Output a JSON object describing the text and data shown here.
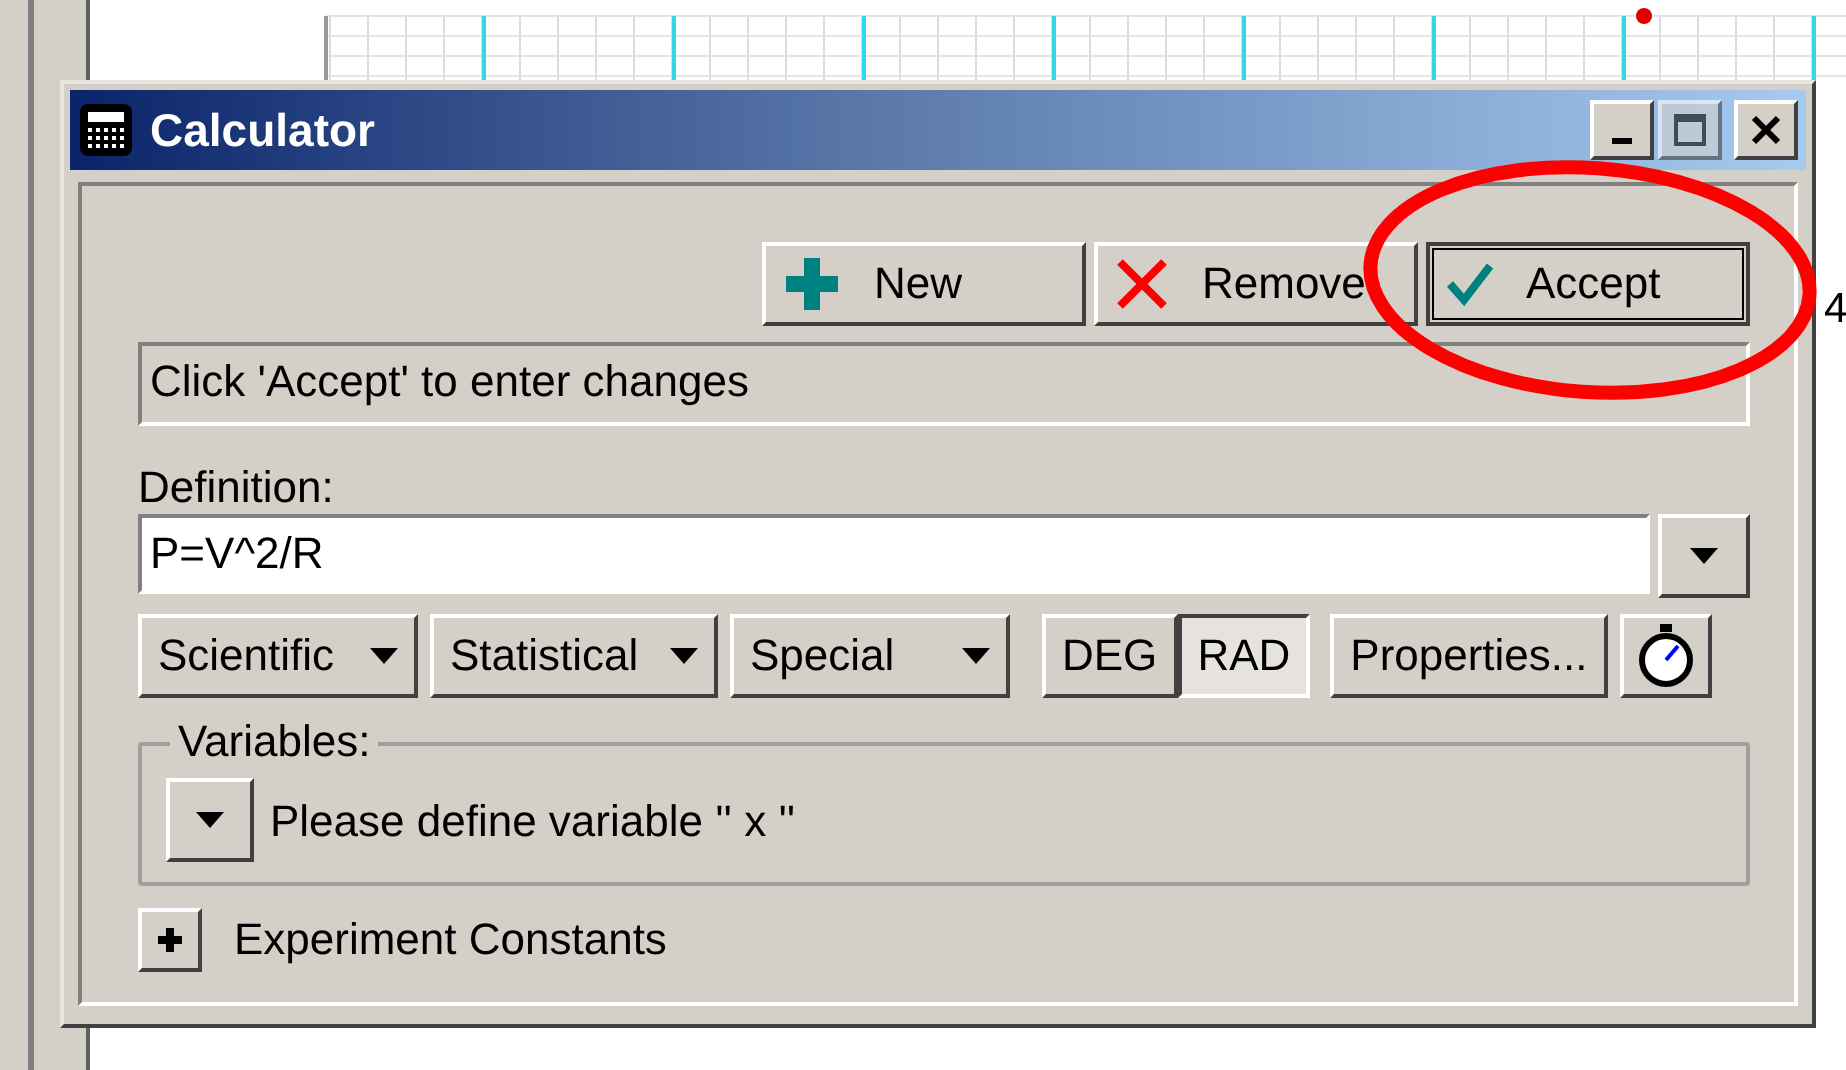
{
  "window": {
    "title": "Calculator"
  },
  "toolbar": [
    {
      "kind": "new",
      "label": "New"
    },
    {
      "kind": "remove",
      "label": "Remove"
    },
    {
      "kind": "accept",
      "label": "Accept"
    }
  ],
  "message": "Click 'Accept' to enter changes",
  "definition": {
    "label": "Definition:",
    "value": "P=V^2/R"
  },
  "function_menus": [
    {
      "label": "Scientific"
    },
    {
      "label": "Statistical"
    },
    {
      "label": "Special"
    }
  ],
  "angle_modes": [
    {
      "label": "DEG",
      "selected": false
    },
    {
      "label": "RAD",
      "selected": true
    }
  ],
  "properties_button": "Properties...",
  "variables": {
    "legend": "Variables:",
    "prompt": "Please define variable '' x ''"
  },
  "constants": {
    "label": "Experiment Constants",
    "expanded": false
  },
  "background_label": "4"
}
